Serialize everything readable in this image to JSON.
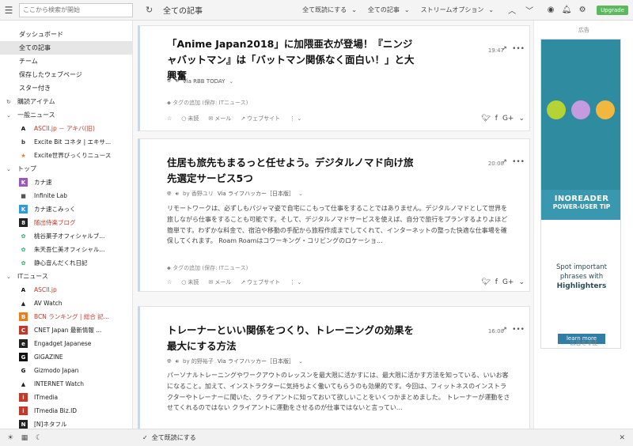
{
  "topbar": {
    "search_placeholder": "ここから検索が開始",
    "page_title": "全ての記事",
    "mark_read": "全て既読にする",
    "filter": "全ての記事",
    "stream_options": "ストリームオプション",
    "upgrade": "Upgrade"
  },
  "sidebar": {
    "nav": [
      "ダッシュボード",
      "全ての記事",
      "チーム",
      "保存したウェブページ",
      "スター付き"
    ],
    "subscriptions": "購読アイテム",
    "folders": [
      {
        "name": "一般ニュース",
        "feeds": [
          {
            "label": "ASCII.jp － アキバ(旧)",
            "icon": "A",
            "bg": "#ffffff",
            "fg": "#000000",
            "red": true
          },
          {
            "label": "Excite Bit コネタ | エキサ...",
            "icon": "b",
            "bg": "#ffffff",
            "fg": "#333333",
            "red": false
          },
          {
            "label": "Excite世界びっくりニュース",
            "icon": "★",
            "bg": "#ffffff",
            "fg": "#e67e22",
            "red": false
          }
        ]
      },
      {
        "name": "トップ",
        "feeds": [
          {
            "label": "カナ速",
            "icon": "K",
            "bg": "#9b59b6",
            "fg": "#ffffff",
            "red": false
          },
          {
            "label": "Infinite Lab",
            "icon": "■",
            "bg": "#ffffff",
            "fg": "#555555",
            "red": false
          },
          {
            "label": "カナ速こみっく",
            "icon": "K",
            "bg": "#3498db",
            "fg": "#ffffff",
            "red": false
          },
          {
            "label": "随出侍楽ブログ",
            "icon": "8",
            "bg": "#222222",
            "fg": "#ffffff",
            "red": true
          },
          {
            "label": "桃谷菓子オフィシャルブ...",
            "icon": "✿",
            "bg": "#ffffff",
            "fg": "#27ae60",
            "red": false
          },
          {
            "label": "朱天吾仁美オフィシャル...",
            "icon": "✿",
            "bg": "#ffffff",
            "fg": "#27ae60",
            "red": false
          },
          {
            "label": "静心音んだくれ日記",
            "icon": "✿",
            "bg": "#ffffff",
            "fg": "#27ae60",
            "red": false
          }
        ]
      },
      {
        "name": "ITニュース",
        "feeds": [
          {
            "label": "ASCII.jp",
            "icon": "A",
            "bg": "#ffffff",
            "fg": "#000000",
            "red": true
          },
          {
            "label": "AV Watch",
            "icon": "▲",
            "bg": "#ffffff",
            "fg": "#222222",
            "red": false
          },
          {
            "label": "BCN ランキング | 総合 記...",
            "icon": "B",
            "bg": "#e67e22",
            "fg": "#ffffff",
            "red": true
          },
          {
            "label": "CNET Japan 最新情報 ...",
            "icon": "C",
            "bg": "#c0392b",
            "fg": "#ffffff",
            "red": false
          },
          {
            "label": "Engadget Japanese",
            "icon": "e",
            "bg": "#222222",
            "fg": "#ffffff",
            "red": false
          },
          {
            "label": "GIGAZINE",
            "icon": "G",
            "bg": "#111111",
            "fg": "#ffffff",
            "red": false
          },
          {
            "label": "Gizmodo Japan",
            "icon": "G",
            "bg": "#ffffff",
            "fg": "#000000",
            "red": false
          },
          {
            "label": "INTERNET Watch",
            "icon": "▲",
            "bg": "#ffffff",
            "fg": "#222222",
            "red": false
          },
          {
            "label": "ITmedia",
            "icon": "i",
            "bg": "#c0392b",
            "fg": "#ffffff",
            "red": false
          },
          {
            "label": "ITmedia Biz.ID",
            "icon": "i",
            "bg": "#c0392b",
            "fg": "#ffffff",
            "red": false
          },
          {
            "label": "[N]ネタフル",
            "icon": "N",
            "bg": "#222222",
            "fg": "#ffffff",
            "red": false
          }
        ]
      }
    ]
  },
  "articles": [
    {
      "title": "「Anime Japan2018」に加隈亜衣が登場！『ニンジャバットマン』は「バットマン関係なく面白い！」と大興奮",
      "time": "19:47",
      "author": "",
      "via": "Via RBB TODAY",
      "body": "",
      "tag": "タグの追加 (保存: ITニュース)",
      "unread": "未読",
      "mail": "メール",
      "website": "ウェブサイト"
    },
    {
      "title": "住居も旅先もまるっと任せよう。デジタルノマド向け旅先選定サービス5つ",
      "time": "20:00",
      "author": "by 香野ユリ",
      "via": "Via ライフハッカー［日本版］",
      "body": "リモートワークは、必ずしもパジャマ姿で自宅にこもって仕事をすることではありません。デジタルノマドとして世界を旅しながら仕事をすることも可能です。そして、デジタルノマドサービスを使えば、自分で旅行をプランするよりよほど簡単です。わずかな料金で、宿泊や移動の手配から旅程作成までしてくれて、インターネットの整った快適な仕事場を確保してくれます。 Roam Roamはコワーキング・コリビングのロケーショ...",
      "tag": "タグの追加 (保存: ITニュース)",
      "unread": "未読",
      "mail": "メール",
      "website": "ウェブサイト"
    },
    {
      "title": "トレーナーといい関係をつくり、トレーニングの効果を最大にする方法",
      "time": "16:00",
      "author": "by 的野裕子",
      "via": "Via ライフハッカー［日本版］",
      "body": "パーソナルトレーニングやワークアウトのレッスンを最大限に活かすには、最大限に活かす方法を知っている、いいお客になること。加えて、インストラクターに気持ちよく働いてもらうのも効果的です。今回は、フィットネスのインストラクターやトレーナーに聞いた、クライアントに知っておいて欲しいことをいくつかまとめました。 トレーナーが運動をさせてくれるのではない クライアントに運動をさせるのが仕事ではないと言ってい..."
    }
  ],
  "ad": {
    "label": "広告",
    "brand": "INOREADER",
    "tip": "POWER-USER TIP",
    "line1": "Spot important",
    "line2": "phrases with",
    "line3": "Highlighters",
    "button": "learn more",
    "hide": "広告を非止",
    "colors": {
      "top": "#2e8ba0",
      "dot1": "#b5d334",
      "dot2": "#c59be0",
      "dot3": "#f1b73f"
    }
  },
  "bottombar": {
    "mark_all": "全て既読にする"
  }
}
